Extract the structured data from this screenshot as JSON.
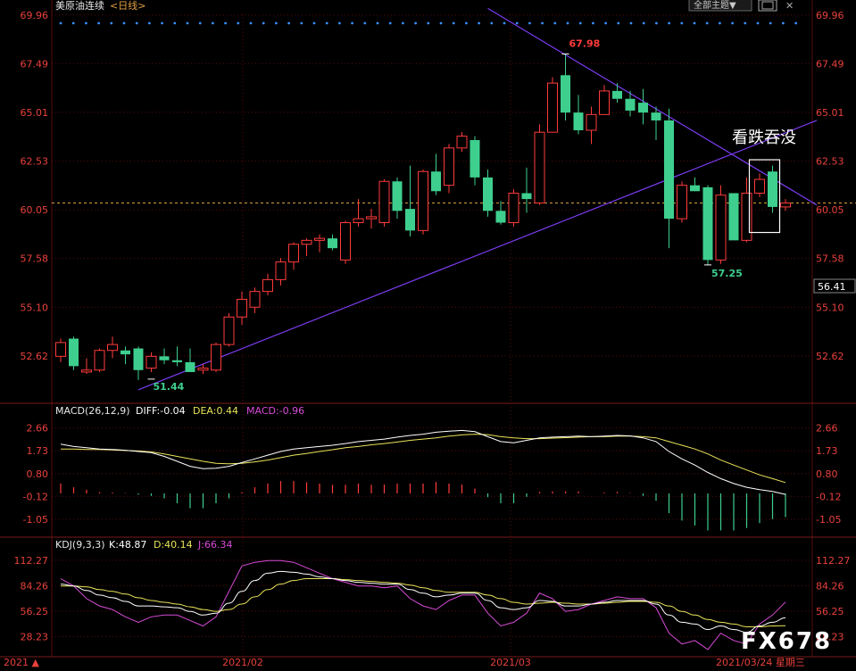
{
  "header": {
    "title": "美原油连续",
    "period": "<日线>",
    "all_button": "全部主题▼"
  },
  "colors": {
    "up": "#ff3b3b",
    "down": "#3ecf8e",
    "price_axis": "#e8413c",
    "grid": "#5a0d0d",
    "trend": "#7b3cf0",
    "diff": "#ffffff",
    "dea": "#e9e45a",
    "macd": "#d84bd8",
    "k": "#ffffff",
    "d": "#e9e45a",
    "j": "#d84bd8"
  },
  "chart_data": [
    {
      "type": "candlestick",
      "title": "美原油连续<日线>",
      "ylim": [
        50.3,
        70.0
      ],
      "yticks": [
        "69.96",
        "67.49",
        "65.01",
        "62.53",
        "60.05",
        "57.58",
        "55.10",
        "52.62"
      ],
      "xticks": [
        "2021/02",
        "2021/03"
      ],
      "last_price_label": "56.41",
      "annotations": {
        "high": "67.98",
        "low1": "51.44",
        "low2": "57.25",
        "text": "看跌吞没"
      },
      "candles": [
        {
          "o": 52.6,
          "h": 53.5,
          "l": 52.3,
          "c": 53.3
        },
        {
          "o": 53.5,
          "h": 53.6,
          "l": 51.9,
          "c": 52.1
        },
        {
          "o": 51.8,
          "h": 52.5,
          "l": 51.7,
          "c": 51.9
        },
        {
          "o": 51.9,
          "h": 53.0,
          "l": 51.8,
          "c": 52.9
        },
        {
          "o": 52.9,
          "h": 53.6,
          "l": 52.5,
          "c": 53.2
        },
        {
          "o": 52.9,
          "h": 53.1,
          "l": 52.2,
          "c": 52.7
        },
        {
          "o": 53.0,
          "h": 53.1,
          "l": 51.4,
          "c": 51.9
        },
        {
          "o": 52.0,
          "h": 52.8,
          "l": 51.8,
          "c": 52.6
        },
        {
          "o": 52.6,
          "h": 53.0,
          "l": 52.2,
          "c": 52.4
        },
        {
          "o": 52.4,
          "h": 53.1,
          "l": 52.1,
          "c": 52.3
        },
        {
          "o": 52.3,
          "h": 53.0,
          "l": 51.8,
          "c": 51.8
        },
        {
          "o": 51.9,
          "h": 52.2,
          "l": 51.7,
          "c": 52.0
        },
        {
          "o": 51.9,
          "h": 53.3,
          "l": 51.8,
          "c": 53.2
        },
        {
          "o": 53.2,
          "h": 54.8,
          "l": 53.1,
          "c": 54.6
        },
        {
          "o": 54.6,
          "h": 55.9,
          "l": 54.2,
          "c": 55.5
        },
        {
          "o": 55.1,
          "h": 56.1,
          "l": 54.8,
          "c": 55.9
        },
        {
          "o": 55.9,
          "h": 56.8,
          "l": 55.7,
          "c": 56.5
        },
        {
          "o": 56.5,
          "h": 57.6,
          "l": 56.2,
          "c": 57.4
        },
        {
          "o": 57.4,
          "h": 58.4,
          "l": 57.0,
          "c": 58.3
        },
        {
          "o": 58.3,
          "h": 58.6,
          "l": 57.7,
          "c": 58.5
        },
        {
          "o": 58.5,
          "h": 58.8,
          "l": 57.9,
          "c": 58.6
        },
        {
          "o": 58.6,
          "h": 58.8,
          "l": 58.0,
          "c": 58.1
        },
        {
          "o": 57.5,
          "h": 59.5,
          "l": 57.3,
          "c": 59.4
        },
        {
          "o": 59.4,
          "h": 60.6,
          "l": 59.2,
          "c": 59.6
        },
        {
          "o": 59.6,
          "h": 60.1,
          "l": 59.1,
          "c": 59.7
        },
        {
          "o": 59.4,
          "h": 61.6,
          "l": 59.2,
          "c": 61.5
        },
        {
          "o": 61.5,
          "h": 61.7,
          "l": 59.6,
          "c": 60.0
        },
        {
          "o": 60.1,
          "h": 62.3,
          "l": 58.7,
          "c": 59.0
        },
        {
          "o": 59.0,
          "h": 62.1,
          "l": 58.8,
          "c": 62.0
        },
        {
          "o": 62.0,
          "h": 62.9,
          "l": 60.8,
          "c": 61.0
        },
        {
          "o": 61.3,
          "h": 63.4,
          "l": 60.9,
          "c": 63.2
        },
        {
          "o": 63.2,
          "h": 64.0,
          "l": 63.0,
          "c": 63.8
        },
        {
          "o": 63.6,
          "h": 63.8,
          "l": 61.3,
          "c": 61.7
        },
        {
          "o": 61.7,
          "h": 62.1,
          "l": 59.7,
          "c": 60.0
        },
        {
          "o": 60.0,
          "h": 60.5,
          "l": 59.3,
          "c": 59.4
        },
        {
          "o": 59.4,
          "h": 61.1,
          "l": 59.2,
          "c": 60.9
        },
        {
          "o": 60.9,
          "h": 62.2,
          "l": 59.9,
          "c": 60.6
        },
        {
          "o": 60.4,
          "h": 64.4,
          "l": 60.3,
          "c": 64.0
        },
        {
          "o": 64.0,
          "h": 66.8,
          "l": 64.0,
          "c": 66.5
        },
        {
          "o": 66.9,
          "h": 67.98,
          "l": 64.6,
          "c": 65.0
        },
        {
          "o": 65.0,
          "h": 65.9,
          "l": 63.9,
          "c": 64.1
        },
        {
          "o": 64.1,
          "h": 65.3,
          "l": 63.4,
          "c": 64.9
        },
        {
          "o": 64.9,
          "h": 66.4,
          "l": 64.9,
          "c": 66.1
        },
        {
          "o": 66.1,
          "h": 66.5,
          "l": 65.5,
          "c": 65.7
        },
        {
          "o": 65.7,
          "h": 66.1,
          "l": 64.8,
          "c": 65.1
        },
        {
          "o": 65.5,
          "h": 66.2,
          "l": 64.4,
          "c": 65.0
        },
        {
          "o": 65.0,
          "h": 65.3,
          "l": 63.6,
          "c": 64.6
        },
        {
          "o": 64.6,
          "h": 65.2,
          "l": 58.1,
          "c": 59.6
        },
        {
          "o": 59.6,
          "h": 61.5,
          "l": 59.4,
          "c": 61.3
        },
        {
          "o": 61.3,
          "h": 61.7,
          "l": 61.0,
          "c": 61.0
        },
        {
          "o": 61.2,
          "h": 61.3,
          "l": 57.25,
          "c": 57.5
        },
        {
          "o": 57.5,
          "h": 61.3,
          "l": 57.3,
          "c": 60.8
        },
        {
          "o": 60.9,
          "h": 60.9,
          "l": 58.6,
          "c": 58.5
        },
        {
          "o": 58.5,
          "h": 61.7,
          "l": 58.4,
          "c": 60.9
        },
        {
          "o": 60.9,
          "h": 61.9,
          "l": 60.7,
          "c": 61.6
        },
        {
          "o": 62.0,
          "h": 62.3,
          "l": 59.9,
          "c": 60.2
        },
        {
          "o": 60.2,
          "h": 60.6,
          "l": 60.0,
          "c": 60.4
        }
      ],
      "trendlines": [
        {
          "from": [
            "2021-01-28",
            51.0
          ],
          "to": [
            "2021-03-24",
            64.5
          ]
        },
        {
          "from": [
            "2021-03-05",
            70.0
          ],
          "to": [
            "2021-03-24",
            60.3
          ]
        }
      ],
      "reference_line": 60.4
    },
    {
      "type": "line",
      "title": "MACD(26,12,9)",
      "legend": {
        "name": "MACD(26,12,9)",
        "diff": "DIFF:-0.04",
        "dea": "DEA:0.44",
        "macd": "MACD:-0.96"
      },
      "ylim": [
        -1.7,
        3.0
      ],
      "yticks": [
        "2.66",
        "1.73",
        "0.80",
        "-0.12",
        "-1.05"
      ],
      "series": [
        {
          "name": "DIFF",
          "values": [
            2.0,
            1.9,
            1.85,
            1.8,
            1.78,
            1.75,
            1.7,
            1.65,
            1.5,
            1.3,
            1.1,
            1.0,
            1.02,
            1.1,
            1.25,
            1.4,
            1.55,
            1.7,
            1.8,
            1.85,
            1.9,
            1.95,
            2.02,
            2.1,
            2.15,
            2.2,
            2.28,
            2.35,
            2.4,
            2.48,
            2.52,
            2.55,
            2.5,
            2.3,
            2.1,
            2.05,
            2.15,
            2.25,
            2.28,
            2.3,
            2.32,
            2.3,
            2.32,
            2.35,
            2.33,
            2.25,
            2.1,
            1.7,
            1.4,
            1.15,
            0.85,
            0.6,
            0.4,
            0.25,
            0.15,
            0.08,
            -0.04
          ]
        },
        {
          "name": "DEA",
          "values": [
            1.8,
            1.8,
            1.78,
            1.78,
            1.76,
            1.74,
            1.72,
            1.68,
            1.6,
            1.5,
            1.4,
            1.3,
            1.22,
            1.2,
            1.22,
            1.28,
            1.35,
            1.45,
            1.55,
            1.62,
            1.7,
            1.77,
            1.85,
            1.9,
            1.97,
            2.02,
            2.08,
            2.15,
            2.2,
            2.25,
            2.32,
            2.37,
            2.4,
            2.38,
            2.3,
            2.25,
            2.22,
            2.22,
            2.24,
            2.26,
            2.28,
            2.3,
            2.3,
            2.32,
            2.32,
            2.3,
            2.25,
            2.1,
            1.95,
            1.8,
            1.6,
            1.35,
            1.15,
            0.95,
            0.75,
            0.6,
            0.44
          ]
        },
        {
          "name": "MACD",
          "values": [
            0.4,
            0.25,
            0.15,
            0.05,
            0.04,
            0.02,
            -0.05,
            -0.1,
            -0.2,
            -0.4,
            -0.6,
            -0.6,
            -0.4,
            -0.2,
            0.05,
            0.25,
            0.4,
            0.5,
            0.5,
            0.45,
            0.4,
            0.35,
            0.35,
            0.4,
            0.35,
            0.36,
            0.4,
            0.4,
            0.4,
            0.46,
            0.4,
            0.36,
            0.2,
            -0.15,
            -0.4,
            -0.4,
            -0.14,
            0.06,
            0.08,
            0.08,
            0.08,
            0.0,
            0.04,
            0.06,
            0.02,
            -0.1,
            -0.3,
            -0.8,
            -1.1,
            -1.3,
            -1.5,
            -1.5,
            -1.5,
            -1.4,
            -1.2,
            -1.04,
            -0.96
          ]
        }
      ]
    },
    {
      "type": "line",
      "title": "KDJ(9,3,3)",
      "legend": {
        "name": "KDJ(9,3,3)",
        "k": "K:48.87",
        "d": "D:40.14",
        "j": "J:66.34"
      },
      "ylim": [
        10,
        122
      ],
      "yticks": [
        "112.27",
        "84.26",
        "56.25",
        "28.23"
      ],
      "series": [
        {
          "name": "K",
          "values": [
            86,
            84,
            79,
            74,
            71,
            67,
            62,
            62,
            61,
            60,
            56,
            52,
            54,
            65,
            78,
            90,
            98,
            100,
            99,
            97,
            94,
            92,
            90,
            88,
            87,
            86,
            86,
            80,
            76,
            72,
            74,
            76,
            76,
            68,
            60,
            58,
            60,
            68,
            67,
            62,
            62,
            64,
            66,
            68,
            68,
            68,
            64,
            52,
            44,
            42,
            36,
            40,
            36,
            33,
            40,
            44,
            48.87
          ]
        },
        {
          "name": "D",
          "values": [
            84,
            84,
            83,
            80,
            78,
            75,
            71,
            68,
            66,
            64,
            61,
            58,
            56,
            58,
            64,
            72,
            80,
            86,
            90,
            92,
            92,
            92,
            91,
            90,
            89,
            88,
            87,
            85,
            82,
            79,
            77,
            77,
            77,
            74,
            70,
            66,
            64,
            65,
            66,
            65,
            64,
            64,
            65,
            66,
            67,
            67,
            66,
            62,
            56,
            52,
            47,
            44,
            42,
            39,
            39,
            40,
            40.14
          ]
        },
        {
          "name": "J",
          "values": [
            92,
            84,
            70,
            62,
            58,
            50,
            44,
            50,
            52,
            52,
            46,
            40,
            50,
            78,
            106,
            110,
            112,
            112,
            110,
            104,
            98,
            92,
            88,
            84,
            84,
            82,
            84,
            70,
            62,
            58,
            68,
            74,
            74,
            54,
            40,
            44,
            54,
            76,
            70,
            56,
            58,
            64,
            68,
            72,
            70,
            70,
            60,
            32,
            20,
            24,
            14,
            32,
            24,
            20,
            42,
            52,
            66.34
          ]
        }
      ]
    }
  ],
  "footer": {
    "left": "2021 ▲",
    "date": "2021/03/24 星期三"
  },
  "watermark": "FX678"
}
